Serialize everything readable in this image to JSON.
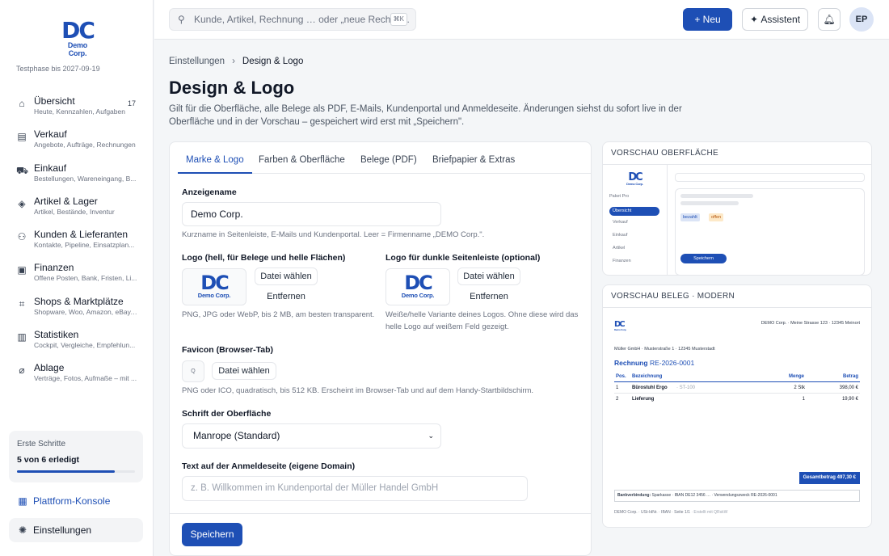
{
  "sidebar": {
    "logo_text": "DC",
    "logo_sub": "Demo Corp.",
    "trial": "Testphase bis 2027-09-19",
    "items": [
      {
        "icon": "home-icon",
        "glyph": "⌂",
        "title": "Übersicht",
        "sub": "Heute, Kennzahlen, Aufgaben",
        "badge": "17"
      },
      {
        "icon": "receipt-icon",
        "glyph": "▤",
        "title": "Verkauf",
        "sub": "Angebote, Aufträge, Rechnungen",
        "badge": ""
      },
      {
        "icon": "cart-icon",
        "glyph": "⛟",
        "title": "Einkauf",
        "sub": "Bestellungen, Wareneingang, B...",
        "badge": ""
      },
      {
        "icon": "box-icon",
        "glyph": "◈",
        "title": "Artikel & Lager",
        "sub": "Artikel, Bestände, Inventur",
        "badge": ""
      },
      {
        "icon": "users-icon",
        "glyph": "⚇",
        "title": "Kunden & Lieferanten",
        "sub": "Kontakte, Pipeline, Einsatzplan...",
        "badge": ""
      },
      {
        "icon": "money-icon",
        "glyph": "▣",
        "title": "Finanzen",
        "sub": "Offene Posten, Bank, Fristen, Li...",
        "badge": ""
      },
      {
        "icon": "shop-icon",
        "glyph": "⌗",
        "title": "Shops & Marktplätze",
        "sub": "Shopware, Woo, Amazon, eBay, ...",
        "badge": ""
      },
      {
        "icon": "chart-icon",
        "glyph": "▥",
        "title": "Statistiken",
        "sub": "Cockpit, Vergleiche, Empfehlun...",
        "badge": ""
      },
      {
        "icon": "paperclip-icon",
        "glyph": "⌀",
        "title": "Ablage",
        "sub": "Verträge, Fotos, Aufmaße – mit ...",
        "badge": ""
      }
    ],
    "steps": {
      "title": "Erste Schritte",
      "value": "5 von 6 erledigt",
      "progress": 0.83
    },
    "platform": "Plattform-Konsole",
    "settings": "Einstellungen"
  },
  "topbar": {
    "search_placeholder": "Kunde, Artikel, Rechnung … oder „neue Rechnu...",
    "shortcut": "⌘K",
    "new_label": "Neu",
    "assistant_label": "Assistent",
    "avatar": "EP"
  },
  "page": {
    "breadcrumb_root": "Einstellungen",
    "breadcrumb_current": "Design & Logo",
    "title": "Design & Logo",
    "description": "Gilt für die Oberfläche, alle Belege als PDF, E-Mails, Kundenportal und Anmeldeseite. Änderungen siehst du sofort live in der Oberfläche und in der Vorschau – gespeichert wird erst mit „Speichern\"."
  },
  "tabs": [
    "Marke & Logo",
    "Farben & Oberfläche",
    "Belege (PDF)",
    "Briefpapier & Extras"
  ],
  "form": {
    "display_name_label": "Anzeigename",
    "display_name_value": "Demo Corp.",
    "display_name_help": "Kurzname in Seitenleiste, E-Mails und Kundenportal. Leer = Firmenname „DEMO Corp.\".",
    "logo_light_label": "Logo (hell, für Belege und helle Flächen)",
    "logo_dark_label": "Logo für dunkle Seitenleiste (optional)",
    "choose_file": "Datei wählen",
    "remove": "Entfernen",
    "logo_light_help": "PNG, JPG oder WebP, bis 2 MB, am besten transparent.",
    "logo_dark_help": "Weiße/helle Variante deines Logos. Ohne diese wird das helle Logo auf weißem Feld gezeigt.",
    "favicon_label": "Favicon (Browser-Tab)",
    "favicon_letter": "Q",
    "favicon_help": "PNG oder ICO, quadratisch, bis 512 KB. Erscheint im Browser-Tab und auf dem Handy-Startbildschirm.",
    "font_label": "Schrift der Oberfläche",
    "font_value": "Manrope (Standard)",
    "login_text_label": "Text auf der Anmeldeseite (eigene Domain)",
    "login_text_placeholder": "z. B. Willkommen im Kundenportal der Müller Handel GmbH",
    "save": "Speichern"
  },
  "preview_ui": {
    "title": "VORSCHAU OBERFLÄCHE",
    "plan": "Paket Pro",
    "items": [
      "Übersicht",
      "Verkauf",
      "Einkauf",
      "Artikel",
      "Finanzen"
    ],
    "badge_paid": "bezahlt",
    "badge_open": "offen",
    "save": "Speichern"
  },
  "preview_doc": {
    "title": "VORSCHAU BELEG · MODERN",
    "sender": "DEMO Corp. · Meine Strasse 123 · 12345 Meinort",
    "recipient": "Müller GmbH · Musterstraße 1 · 12345 Musterstadt",
    "doc_type": "Rechnung",
    "doc_number": "RE-2026-0001",
    "cols": [
      "Pos.",
      "Bezeichnung",
      "Menge",
      "Betrag"
    ],
    "rows": [
      {
        "pos": "1",
        "name": "Bürostuhl Ergo",
        "sku": "· ST-100",
        "qty": "2 Stk",
        "amount": "398,00 €"
      },
      {
        "pos": "2",
        "name": "Lieferung",
        "sku": "",
        "qty": "1",
        "amount": "19,90 €"
      }
    ],
    "total": "Gesamtbetrag 497,30 €",
    "bank_label": "Bankverbindung:",
    "bank": "Sparkasse · IBAN DE12 3456 … · Verwendungszweck RE-2026-0001",
    "footer": "DEMO Corp. · USt-IdNr. · IBAN · Seite 1/1",
    "footer_extra": "· Erstellt mit QRskW"
  }
}
